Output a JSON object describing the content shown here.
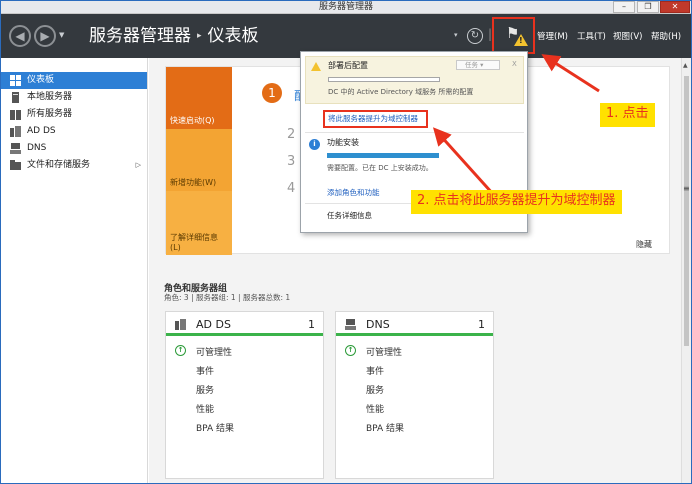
{
  "window": {
    "title": "服务器管理器",
    "minimize": "–",
    "restore": "❐",
    "close": "✕"
  },
  "header": {
    "title": "服务器管理器",
    "breadcrumb_sep": "▸",
    "page": "仪表板",
    "menus": [
      "管理(M)",
      "工具(T)",
      "视图(V)",
      "帮助(H)"
    ]
  },
  "sidebar": {
    "items": [
      {
        "label": "仪表板",
        "icon": "dashboard-grid-icon",
        "active": true
      },
      {
        "label": "本地服务器",
        "icon": "server-icon"
      },
      {
        "label": "所有服务器",
        "icon": "servers-icon"
      },
      {
        "label": "AD DS",
        "icon": "ad-ds-icon"
      },
      {
        "label": "DNS",
        "icon": "dns-icon"
      },
      {
        "label": "文件和存储服务",
        "icon": "storage-icon",
        "arrow": "▷"
      }
    ]
  },
  "welcome": {
    "tiles": [
      "快速启动(Q)",
      "新增功能(W)",
      "了解详细信息(L)"
    ],
    "step1_num": "1",
    "step1_text": "配",
    "steps": [
      "2",
      "3",
      "4"
    ],
    "hide": "隐藏"
  },
  "roles": {
    "title": "角色和服务器组",
    "subtitle": "角色: 3 | 服务器组: 1 | 服务器总数: 1",
    "cards": [
      {
        "name": "AD DS",
        "count": "1",
        "icon": "ad-ds-icon",
        "rows": [
          "可管理性",
          "事件",
          "服务",
          "性能",
          "BPA 结果"
        ]
      },
      {
        "name": "DNS",
        "count": "1",
        "icon": "dns-icon",
        "rows": [
          "可管理性",
          "事件",
          "服务",
          "性能",
          "BPA 结果"
        ]
      }
    ]
  },
  "popup": {
    "deploy_title": "部署后配置",
    "task_label": "任务",
    "close": "X",
    "deploy_desc": "DC 中的 Active Directory 域服务 所需的配置",
    "promote_link": "将此服务器提升为域控制器",
    "install_title": "功能安装",
    "install_desc": "需要配置。已在 DC 上安装成功。",
    "add_roles": "添加角色和功能",
    "task_details": "任务详细信息"
  },
  "annotations": {
    "step1": "1. 点击",
    "step2": "2. 点击将此服务器提升为域控制器"
  },
  "colors": {
    "header": "#34393e",
    "accent": "#2d7fd5",
    "orange": "#e36c16",
    "annotation_red": "#e8321e",
    "annotation_yellow": "#ffe100"
  }
}
